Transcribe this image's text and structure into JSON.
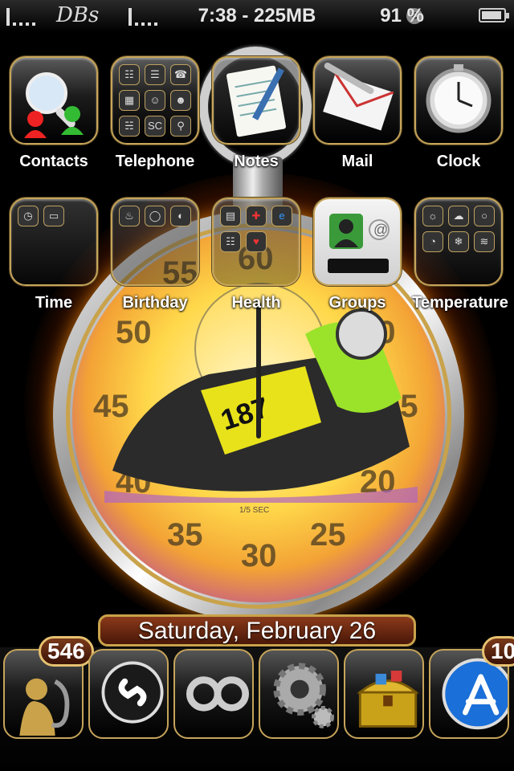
{
  "status_bar": {
    "carrier": "DBs",
    "time_memory": "7:38 - 225MB",
    "battery_percent": "91 %",
    "battery_level": 0.91
  },
  "home_rows": [
    [
      {
        "name": "contacts",
        "label": "Contacts",
        "icon": "contacts-search-icon"
      },
      {
        "name": "telephone",
        "label": "Telephone",
        "icon": "telephone-folder-icon"
      },
      {
        "name": "notes",
        "label": "Notes",
        "icon": "notes-notepad-icon"
      },
      {
        "name": "mail",
        "label": "Mail",
        "icon": "mail-envelope-icon"
      },
      {
        "name": "clock",
        "label": "Clock",
        "icon": "clock-watch-icon"
      }
    ],
    [
      {
        "name": "time",
        "label": "Time",
        "icon": "time-folder-icon"
      },
      {
        "name": "birthday",
        "label": "Birthday",
        "icon": "birthday-folder-icon"
      },
      {
        "name": "health",
        "label": "Health",
        "icon": "health-folder-icon"
      },
      {
        "name": "groups",
        "label": "Groups",
        "icon": "groups-contact-icon"
      },
      {
        "name": "temperature",
        "label": "Temperature",
        "icon": "temperature-folder-icon"
      }
    ]
  ],
  "telephone_folder_glyphs": [
    "☷",
    "☰",
    "☎",
    "▦",
    "☺",
    "☻",
    "☵",
    "SC",
    "⚲"
  ],
  "wallpaper": {
    "stopwatch_numbers": [
      "55",
      "60",
      "50",
      "45",
      "40",
      "35",
      "30",
      "25",
      "20",
      "15",
      "10"
    ],
    "stopwatch_caption": "1/5 SEC",
    "rider_number": "187"
  },
  "date_banner": "Saturday, February 26",
  "dock": [
    {
      "name": "saxophone-app",
      "icon": "saxophone-icon",
      "badge": "546"
    },
    {
      "name": "shazam-app",
      "icon": "shazam-icon",
      "badge": ""
    },
    {
      "name": "infinity-app",
      "icon": "infinity-icon",
      "badge": ""
    },
    {
      "name": "settings-app",
      "icon": "gears-icon",
      "badge": ""
    },
    {
      "name": "treasure-app",
      "icon": "treasure-chest-icon",
      "badge": ""
    },
    {
      "name": "app-store",
      "icon": "app-store-icon",
      "badge": "10"
    }
  ],
  "colors": {
    "gold_border": "#c6a45a",
    "fire": "#ff8a00",
    "badge_bg": "#5a2410"
  }
}
